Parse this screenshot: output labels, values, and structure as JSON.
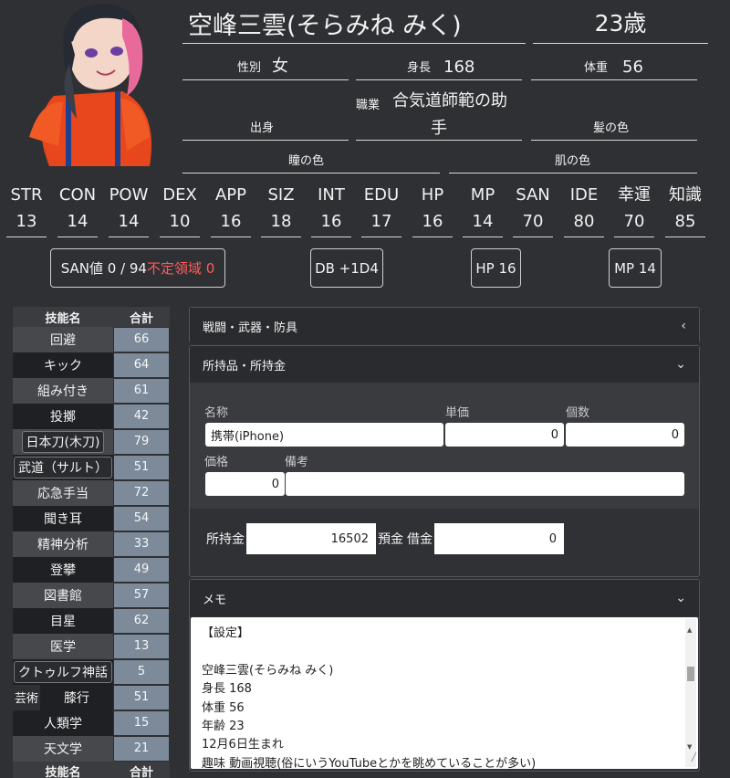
{
  "character": {
    "name": "空峰三雲(そらみね みく)",
    "age": "23歳",
    "sex_label": "性別",
    "sex_value": "女",
    "height_label": "身長",
    "height_value": "168",
    "weight_label": "体重",
    "weight_value": "56",
    "birthplace_label": "出身",
    "job_label": "職業",
    "job_value_line1": "合気道師範の助",
    "job_value_line2": "手",
    "hair_label": "髪の色",
    "eye_label": "瞳の色",
    "skin_label": "肌の色"
  },
  "stats": [
    {
      "label": "STR",
      "value": "13"
    },
    {
      "label": "CON",
      "value": "14"
    },
    {
      "label": "POW",
      "value": "14"
    },
    {
      "label": "DEX",
      "value": "10"
    },
    {
      "label": "APP",
      "value": "16"
    },
    {
      "label": "SIZ",
      "value": "18"
    },
    {
      "label": "INT",
      "value": "16"
    },
    {
      "label": "EDU",
      "value": "17"
    },
    {
      "label": "HP",
      "value": "16"
    },
    {
      "label": "MP",
      "value": "14"
    },
    {
      "label": "SAN",
      "value": "70"
    },
    {
      "label": "IDE",
      "value": "80"
    },
    {
      "label": "幸運",
      "value": "70"
    },
    {
      "label": "知識",
      "value": "85"
    }
  ],
  "derived": {
    "san_text": "SAN値 0 / 94",
    "san_warning": "不定領域 0",
    "db": "DB +1D4",
    "hp": "HP 16",
    "mp": "MP 14"
  },
  "skills": {
    "header_name": "技能名",
    "header_total": "合計",
    "art_label": "芸術",
    "rows": [
      {
        "name": "回避",
        "value": "66"
      },
      {
        "name": "キック",
        "value": "64"
      },
      {
        "name": "組み付き",
        "value": "61"
      },
      {
        "name": "投擲",
        "value": "42"
      },
      {
        "name": "日本刀(木刀)",
        "value": "79"
      },
      {
        "name": "武道（サルト）",
        "value": "51"
      },
      {
        "name": "応急手当",
        "value": "72"
      },
      {
        "name": "聞き耳",
        "value": "54"
      },
      {
        "name": "精神分析",
        "value": "33"
      },
      {
        "name": "登攀",
        "value": "49"
      },
      {
        "name": "図書館",
        "value": "57"
      },
      {
        "name": "目星",
        "value": "62"
      },
      {
        "name": "医学",
        "value": "13"
      },
      {
        "name": "クトゥルフ神話",
        "value": "5"
      },
      {
        "name": "膝行",
        "value": "51"
      },
      {
        "name": "人類学",
        "value": "15"
      },
      {
        "name": "天文学",
        "value": "21"
      }
    ]
  },
  "panels": {
    "combat_title": "戦闘・武器・防具",
    "inventory_title": "所持品・所持金",
    "memo_title": "メモ"
  },
  "inventory": {
    "col_name": "名称",
    "col_unit_price": "単価",
    "col_count": "個数",
    "col_price": "価格",
    "col_note": "備考",
    "item_name": "携帯(iPhone)",
    "item_unit_price": "0",
    "item_count": "0",
    "item_price": "0",
    "item_note": "",
    "money_label": "所持金",
    "money_value": "16502",
    "deposit_label": "預金",
    "debt_label": "借金",
    "debt_value": "0"
  },
  "memo": {
    "lines": [
      "【設定】",
      "",
      "空峰三雲(そらみね みく)",
      "身長 168",
      "体重 56",
      "年齢 23",
      "12月6日生まれ",
      "趣味 動画視聴(俗にいうYouTubeとかを眺めていることが多い)"
    ]
  }
}
